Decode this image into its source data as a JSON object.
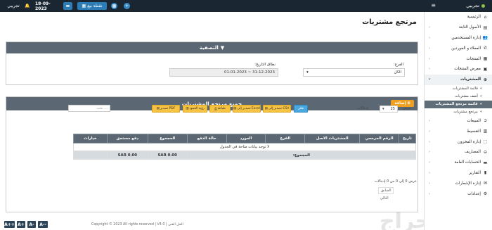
{
  "topbar": {
    "brand": "تجريبي",
    "user": "تجريبي",
    "date": "18-09-2023",
    "pos_label": "نقطة بيع"
  },
  "page": {
    "title": "مرتجع مشتريات"
  },
  "filter": {
    "title": "التصفية",
    "branch_label": "الفرع:",
    "branch_value": "الكل",
    "date_label": "نطاق التاريخ:",
    "date_value": "01-01-2023 ~ 31-12-2023"
  },
  "list": {
    "title": "جميع مرتجع المشتريات",
    "add_label": "إضافة",
    "show_label": "عرض",
    "show_value": "25",
    "entries_label": "إدخالات",
    "search_placeholder": "بحث ...",
    "export": {
      "csv": "تصدير إلى CSV",
      "excel": "تصدير إلى Excel",
      "print": "طباعة",
      "columns": "رؤية العمود",
      "pdf": "تصدير PDF",
      "filter": "فلتر"
    },
    "columns": [
      "تاريخ",
      "الرقم المرجعي",
      "المشتريات الاصل",
      "الفرع",
      "المورد",
      "حالة الدفع",
      "المجموع",
      "دفع مستحق",
      "خيارات"
    ],
    "empty_text": "لا توجد بيانات متاحة في الجدول",
    "total_label": "المجموع:",
    "total_sum": "SAR 0.00",
    "total_due": "SAR 0.00",
    "info_text": "عرض 0 إلى 0 من 0 إدخالات",
    "prev": "السابق",
    "next": "التالي"
  },
  "footer": "Copyright © 2023 All rights reserved | V4.0 | الحل الفني",
  "zoom": [
    "A--",
    "A-",
    "A+",
    "A++"
  ],
  "sidebar": [
    {
      "label": "الرئيسية",
      "icon": "home-icon",
      "glyph": "⌂"
    },
    {
      "label": "الأصول الثابتة",
      "icon": "building-icon",
      "glyph": "▤"
    },
    {
      "label": "إدارة المستخدمين",
      "icon": "users-icon",
      "glyph": "👥"
    },
    {
      "label": "العملاء و الموردين",
      "icon": "contacts-icon",
      "glyph": "✆"
    },
    {
      "label": "المنتجات",
      "icon": "cubes-icon",
      "glyph": "▦"
    },
    {
      "label": "معرض المنتجات",
      "icon": "gallery-icon",
      "glyph": "▣"
    },
    {
      "label": "المشتريات",
      "icon": "plus-circle-icon",
      "glyph": "⊕",
      "active": true
    },
    {
      "label": "قائمة المشتريات",
      "sub": true
    },
    {
      "label": "أضف مشتريات",
      "sub": true
    },
    {
      "label": "قائمة مرتجع المشتريات",
      "sub": true,
      "current": true
    },
    {
      "label": "مرتجع مشتريات",
      "sub": true
    },
    {
      "label": "المبيعات",
      "icon": "arrow-circle-icon",
      "glyph": "➲"
    },
    {
      "label": "التقسيط",
      "icon": "installment-icon",
      "glyph": "▥"
    },
    {
      "label": "إدارة المخزون",
      "icon": "stock-icon",
      "glyph": "⬚"
    },
    {
      "label": "المصاريف",
      "icon": "minus-circle-icon",
      "glyph": "⊖"
    },
    {
      "label": "الحسابات العامة",
      "icon": "money-icon",
      "glyph": "▬"
    },
    {
      "label": "التقارير",
      "icon": "chart-icon",
      "glyph": "▮"
    },
    {
      "label": "إدارة الإشعارات",
      "icon": "envelope-icon",
      "glyph": "✉"
    },
    {
      "label": "إعدادات",
      "icon": "gear-icon",
      "glyph": "⚙"
    }
  ]
}
